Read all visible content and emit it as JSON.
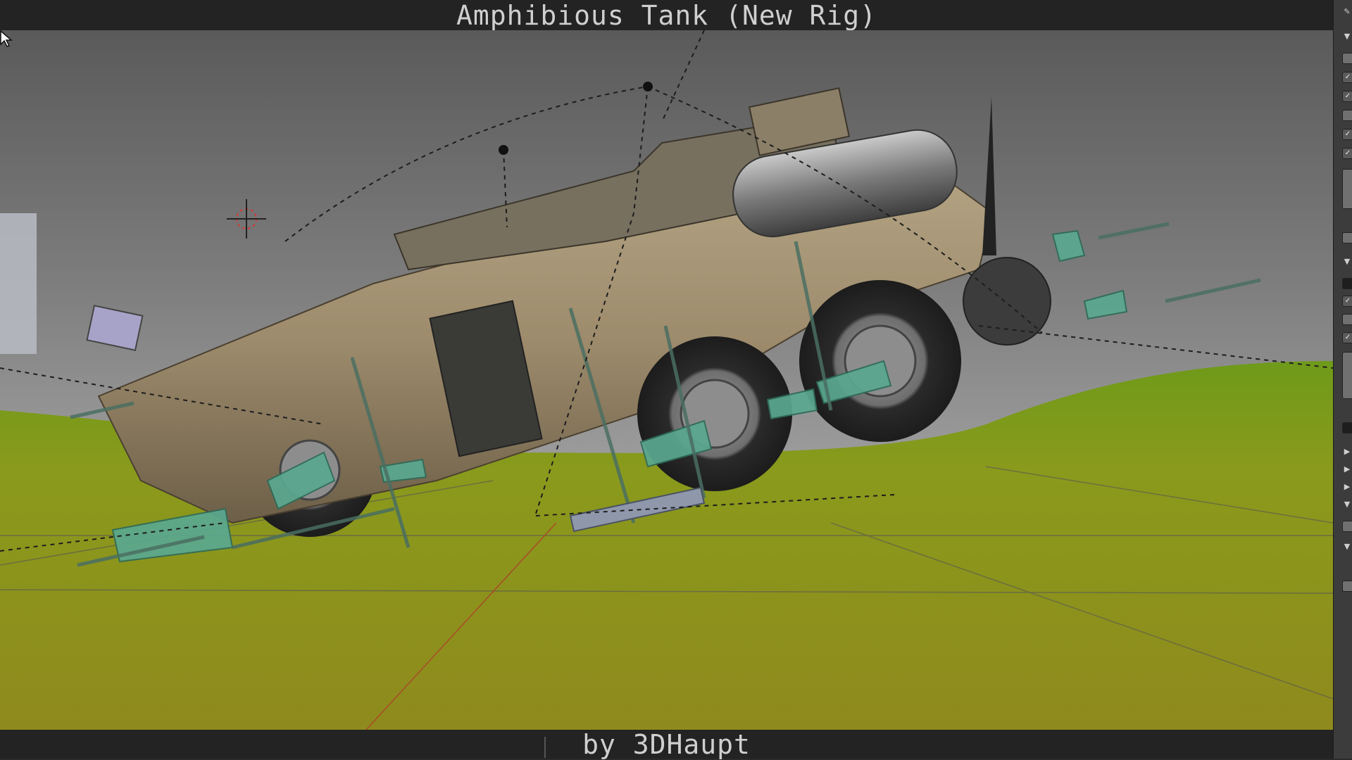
{
  "title_bar": {
    "text": "Amphibious Tank (New Rig)"
  },
  "footer": {
    "text": "by 3DHaupt"
  },
  "viewport": {
    "sky_color": "#7d7d7d",
    "ground_color": "#8a8e1c",
    "hill_color": "#4f9a1c",
    "vehicle_color": "#9d8b6c",
    "rig_bone_color": "#5aa890"
  },
  "side_panel": {
    "icons": [
      "expand-triangle-icon",
      "checkbox-icon",
      "field-icon"
    ]
  }
}
